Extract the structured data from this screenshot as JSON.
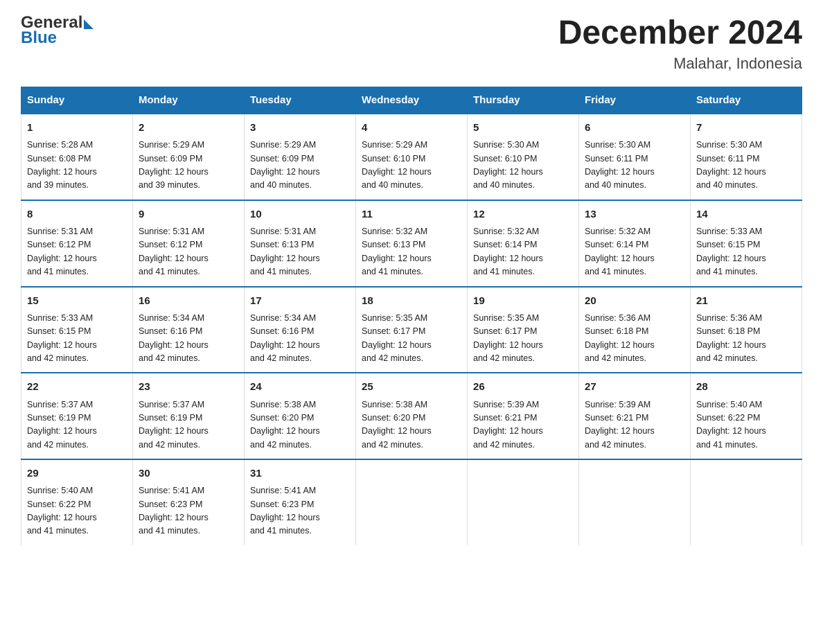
{
  "header": {
    "logo_general": "General",
    "logo_blue": "Blue",
    "title": "December 2024",
    "subtitle": "Malahar, Indonesia"
  },
  "days_of_week": [
    "Sunday",
    "Monday",
    "Tuesday",
    "Wednesday",
    "Thursday",
    "Friday",
    "Saturday"
  ],
  "weeks": [
    [
      {
        "day": "1",
        "sunrise": "5:28 AM",
        "sunset": "6:08 PM",
        "daylight": "12 hours and 39 minutes."
      },
      {
        "day": "2",
        "sunrise": "5:29 AM",
        "sunset": "6:09 PM",
        "daylight": "12 hours and 39 minutes."
      },
      {
        "day": "3",
        "sunrise": "5:29 AM",
        "sunset": "6:09 PM",
        "daylight": "12 hours and 40 minutes."
      },
      {
        "day": "4",
        "sunrise": "5:29 AM",
        "sunset": "6:10 PM",
        "daylight": "12 hours and 40 minutes."
      },
      {
        "day": "5",
        "sunrise": "5:30 AM",
        "sunset": "6:10 PM",
        "daylight": "12 hours and 40 minutes."
      },
      {
        "day": "6",
        "sunrise": "5:30 AM",
        "sunset": "6:11 PM",
        "daylight": "12 hours and 40 minutes."
      },
      {
        "day": "7",
        "sunrise": "5:30 AM",
        "sunset": "6:11 PM",
        "daylight": "12 hours and 40 minutes."
      }
    ],
    [
      {
        "day": "8",
        "sunrise": "5:31 AM",
        "sunset": "6:12 PM",
        "daylight": "12 hours and 41 minutes."
      },
      {
        "day": "9",
        "sunrise": "5:31 AM",
        "sunset": "6:12 PM",
        "daylight": "12 hours and 41 minutes."
      },
      {
        "day": "10",
        "sunrise": "5:31 AM",
        "sunset": "6:13 PM",
        "daylight": "12 hours and 41 minutes."
      },
      {
        "day": "11",
        "sunrise": "5:32 AM",
        "sunset": "6:13 PM",
        "daylight": "12 hours and 41 minutes."
      },
      {
        "day": "12",
        "sunrise": "5:32 AM",
        "sunset": "6:14 PM",
        "daylight": "12 hours and 41 minutes."
      },
      {
        "day": "13",
        "sunrise": "5:32 AM",
        "sunset": "6:14 PM",
        "daylight": "12 hours and 41 minutes."
      },
      {
        "day": "14",
        "sunrise": "5:33 AM",
        "sunset": "6:15 PM",
        "daylight": "12 hours and 41 minutes."
      }
    ],
    [
      {
        "day": "15",
        "sunrise": "5:33 AM",
        "sunset": "6:15 PM",
        "daylight": "12 hours and 42 minutes."
      },
      {
        "day": "16",
        "sunrise": "5:34 AM",
        "sunset": "6:16 PM",
        "daylight": "12 hours and 42 minutes."
      },
      {
        "day": "17",
        "sunrise": "5:34 AM",
        "sunset": "6:16 PM",
        "daylight": "12 hours and 42 minutes."
      },
      {
        "day": "18",
        "sunrise": "5:35 AM",
        "sunset": "6:17 PM",
        "daylight": "12 hours and 42 minutes."
      },
      {
        "day": "19",
        "sunrise": "5:35 AM",
        "sunset": "6:17 PM",
        "daylight": "12 hours and 42 minutes."
      },
      {
        "day": "20",
        "sunrise": "5:36 AM",
        "sunset": "6:18 PM",
        "daylight": "12 hours and 42 minutes."
      },
      {
        "day": "21",
        "sunrise": "5:36 AM",
        "sunset": "6:18 PM",
        "daylight": "12 hours and 42 minutes."
      }
    ],
    [
      {
        "day": "22",
        "sunrise": "5:37 AM",
        "sunset": "6:19 PM",
        "daylight": "12 hours and 42 minutes."
      },
      {
        "day": "23",
        "sunrise": "5:37 AM",
        "sunset": "6:19 PM",
        "daylight": "12 hours and 42 minutes."
      },
      {
        "day": "24",
        "sunrise": "5:38 AM",
        "sunset": "6:20 PM",
        "daylight": "12 hours and 42 minutes."
      },
      {
        "day": "25",
        "sunrise": "5:38 AM",
        "sunset": "6:20 PM",
        "daylight": "12 hours and 42 minutes."
      },
      {
        "day": "26",
        "sunrise": "5:39 AM",
        "sunset": "6:21 PM",
        "daylight": "12 hours and 42 minutes."
      },
      {
        "day": "27",
        "sunrise": "5:39 AM",
        "sunset": "6:21 PM",
        "daylight": "12 hours and 42 minutes."
      },
      {
        "day": "28",
        "sunrise": "5:40 AM",
        "sunset": "6:22 PM",
        "daylight": "12 hours and 41 minutes."
      }
    ],
    [
      {
        "day": "29",
        "sunrise": "5:40 AM",
        "sunset": "6:22 PM",
        "daylight": "12 hours and 41 minutes."
      },
      {
        "day": "30",
        "sunrise": "5:41 AM",
        "sunset": "6:23 PM",
        "daylight": "12 hours and 41 minutes."
      },
      {
        "day": "31",
        "sunrise": "5:41 AM",
        "sunset": "6:23 PM",
        "daylight": "12 hours and 41 minutes."
      },
      null,
      null,
      null,
      null
    ]
  ],
  "labels": {
    "sunrise": "Sunrise:",
    "sunset": "Sunset:",
    "daylight": "Daylight:"
  }
}
